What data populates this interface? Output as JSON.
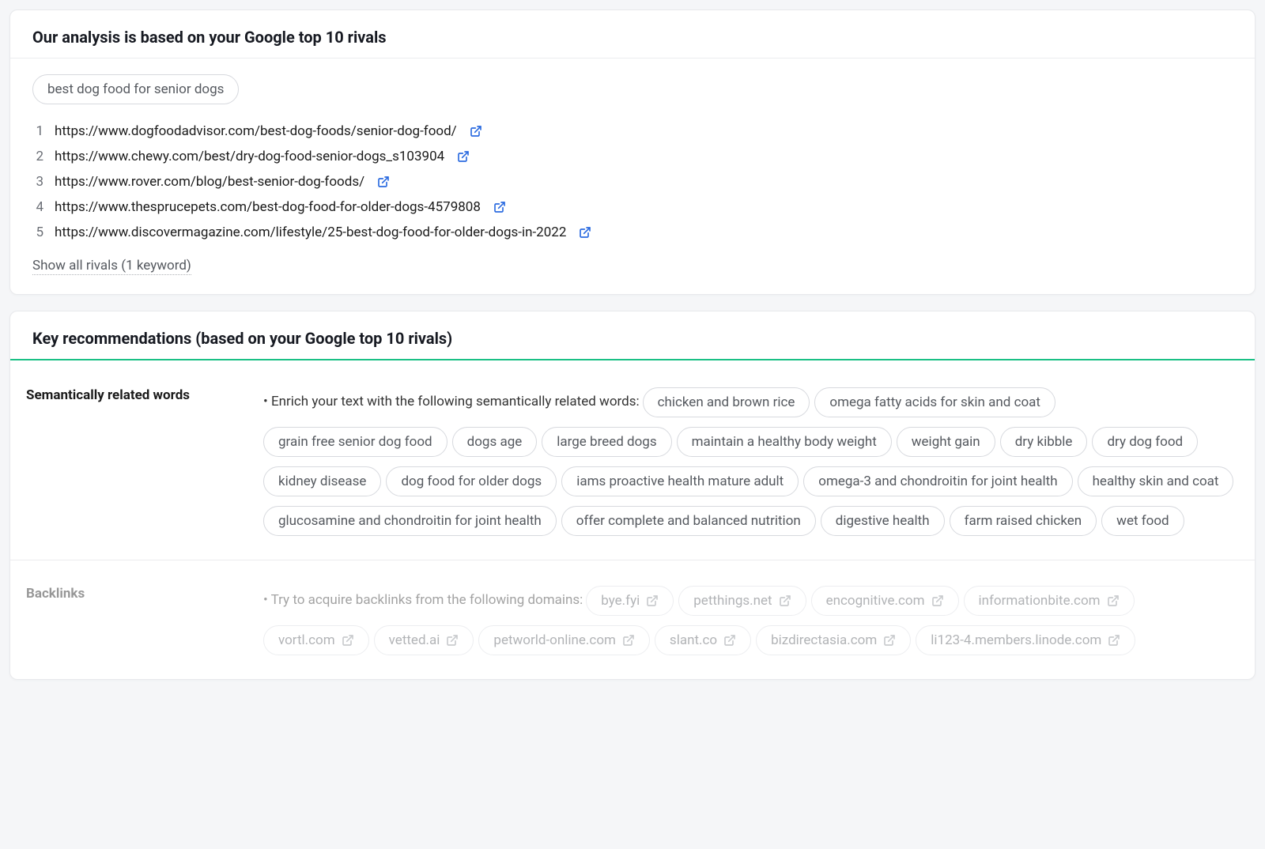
{
  "analysis": {
    "title": "Our analysis is based on your Google top 10 rivals",
    "keyword": "best dog food for senior dogs",
    "rivals": [
      {
        "n": "1",
        "url": "https://www.dogfoodadvisor.com/best-dog-foods/senior-dog-food/"
      },
      {
        "n": "2",
        "url": "https://www.chewy.com/best/dry-dog-food-senior-dogs_s103904"
      },
      {
        "n": "3",
        "url": "https://www.rover.com/blog/best-senior-dog-foods/"
      },
      {
        "n": "4",
        "url": "https://www.thesprucepets.com/best-dog-food-for-older-dogs-4579808"
      },
      {
        "n": "5",
        "url": "https://www.discovermagazine.com/lifestyle/25-best-dog-food-for-older-dogs-in-2022"
      }
    ],
    "show_all_label": "Show all rivals (1 keyword)"
  },
  "recommendations": {
    "title": "Key recommendations (based on your Google top 10 rivals)",
    "semantic": {
      "label": "Semantically related words",
      "lead": "Enrich your text with the following semantically related words:",
      "words": [
        "chicken and brown rice",
        "omega fatty acids for skin and coat",
        "grain free senior dog food",
        "dogs age",
        "large breed dogs",
        "maintain a healthy body weight",
        "weight gain",
        "dry kibble",
        "dry dog food",
        "kidney disease",
        "dog food for older dogs",
        "iams proactive health mature adult",
        "omega-3 and chondroitin for joint health",
        "healthy skin and coat",
        "glucosamine and chondroitin for joint health",
        "offer complete and balanced nutrition",
        "digestive health",
        "farm raised chicken",
        "wet food"
      ]
    },
    "backlinks": {
      "label": "Backlinks",
      "lead": "Try to acquire backlinks from the following domains:",
      "domains": [
        "bye.fyi",
        "petthings.net",
        "encognitive.com",
        "informationbite.com",
        "vortl.com",
        "vetted.ai",
        "petworld-online.com",
        "slant.co",
        "bizdirectasia.com",
        "li123-4.members.linode.com"
      ]
    }
  }
}
